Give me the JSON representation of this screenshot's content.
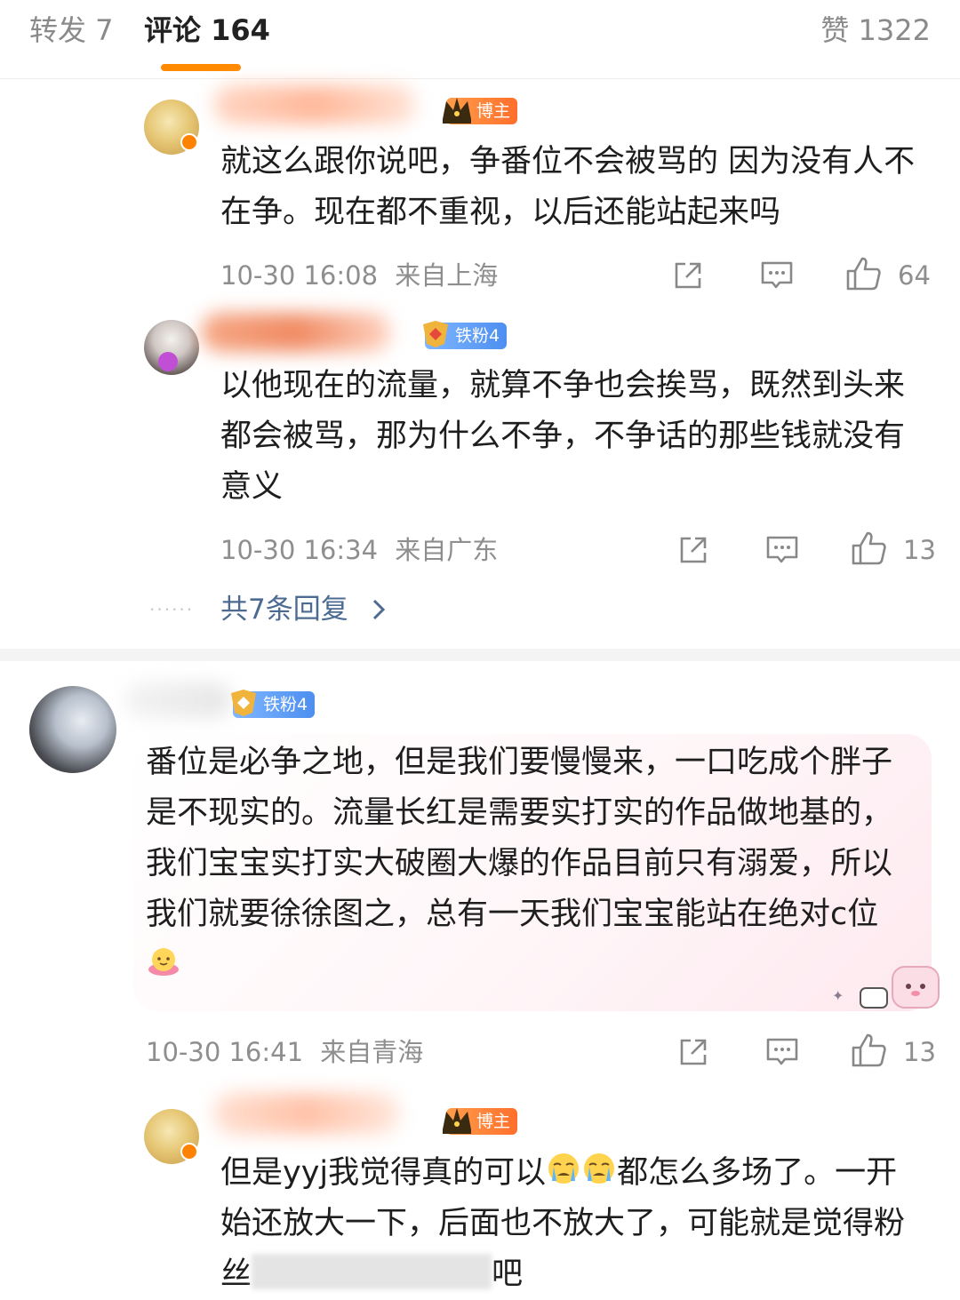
{
  "tabs": {
    "repost": "转发 7",
    "comments": "评论 164",
    "likes": "赞 1322"
  },
  "colors": {
    "accent": "#ff8a00",
    "link": "#4d6b91",
    "blogger_badge": "#ff7a2f",
    "fan_badge": "#5b97f2"
  },
  "comments": [
    {
      "badge": "博主",
      "text": "就这么跟你说吧，争番位不会被骂的 因为没有人不在争。现在都不重视，以后还能站起来吗",
      "time": "10-30 16:08",
      "location": "来自上海",
      "likes": "64"
    },
    {
      "badge": "铁粉4",
      "text": "以他现在的流量，就算不争也会挨骂，既然到头来都会被骂，那为什么不争，不争话的那些钱就没有意义",
      "time": "10-30 16:34",
      "location": "来自广东",
      "likes": "13",
      "replies_label": "共7条回复",
      "replies_dots": "······"
    },
    {
      "badge": "铁粉4",
      "text": "番位是必争之地，但是我们要慢慢来，一口吃成个胖子是不现实的。流量长红是需要实打实的作品做地基的，我们宝宝实打实大破圈大爆的作品目前只有溺爱，所以我们就要徐徐图之，总有一天我们宝宝能站在绝对c位",
      "time": "10-30 16:41",
      "location": "来自青海",
      "likes": "13"
    },
    {
      "badge": "博主",
      "text_a": "但是yyj我觉得真的可以",
      "text_b": "都怎么多场了。一开始还放大一下，后面也不放大了，可能就是觉得粉丝",
      "text_c": "吧"
    }
  ],
  "icons": [
    "share-icon",
    "comment-icon",
    "like-icon",
    "crying-emoji-icon",
    "cake-emoji-icon",
    "crown-icon",
    "fan-medal-icon"
  ]
}
